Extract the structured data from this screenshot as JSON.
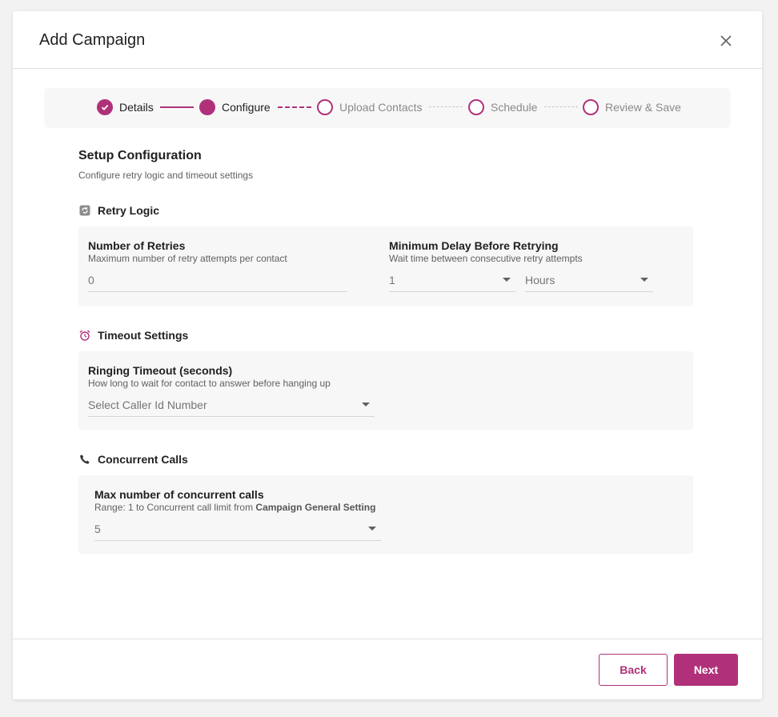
{
  "modal": {
    "title": "Add Campaign"
  },
  "colors": {
    "accent": "#b0317a",
    "card_bg": "#f7f7f7",
    "muted_text": "#8a8a8a"
  },
  "stepper": {
    "steps": [
      {
        "label": "Details",
        "state": "completed"
      },
      {
        "label": "Configure",
        "state": "current"
      },
      {
        "label": "Upload Contacts",
        "state": "pending"
      },
      {
        "label": "Schedule",
        "state": "pending"
      },
      {
        "label": "Review & Save",
        "state": "pending"
      }
    ]
  },
  "setup": {
    "title": "Setup Configuration",
    "subtitle": "Configure retry logic and timeout settings"
  },
  "retry_logic": {
    "heading": "Retry Logic",
    "icon": "refresh-icon",
    "retries": {
      "label": "Number of Retries",
      "help": "Maximum number of retry attempts per contact",
      "value": "0"
    },
    "delay": {
      "label": "Minimum Delay Before Retrying",
      "help": "Wait time between consecutive retry attempts",
      "amount": "1",
      "unit": "Hours"
    }
  },
  "timeout": {
    "heading": "Timeout Settings",
    "icon": "alarm-clock-icon",
    "ringing": {
      "label": "Ringing Timeout (seconds)",
      "help": "How long to wait for contact to answer before hanging up",
      "placeholder": "Select Caller Id Number"
    }
  },
  "concurrent": {
    "heading": "Concurrent Calls",
    "icon": "phone-icon",
    "max": {
      "label": "Max number of concurrent calls",
      "help_prefix": "Range: 1 to Concurrent call limit from ",
      "help_bold": "Campaign General Setting",
      "value": "5"
    }
  },
  "footer": {
    "back_label": "Back",
    "next_label": "Next"
  }
}
